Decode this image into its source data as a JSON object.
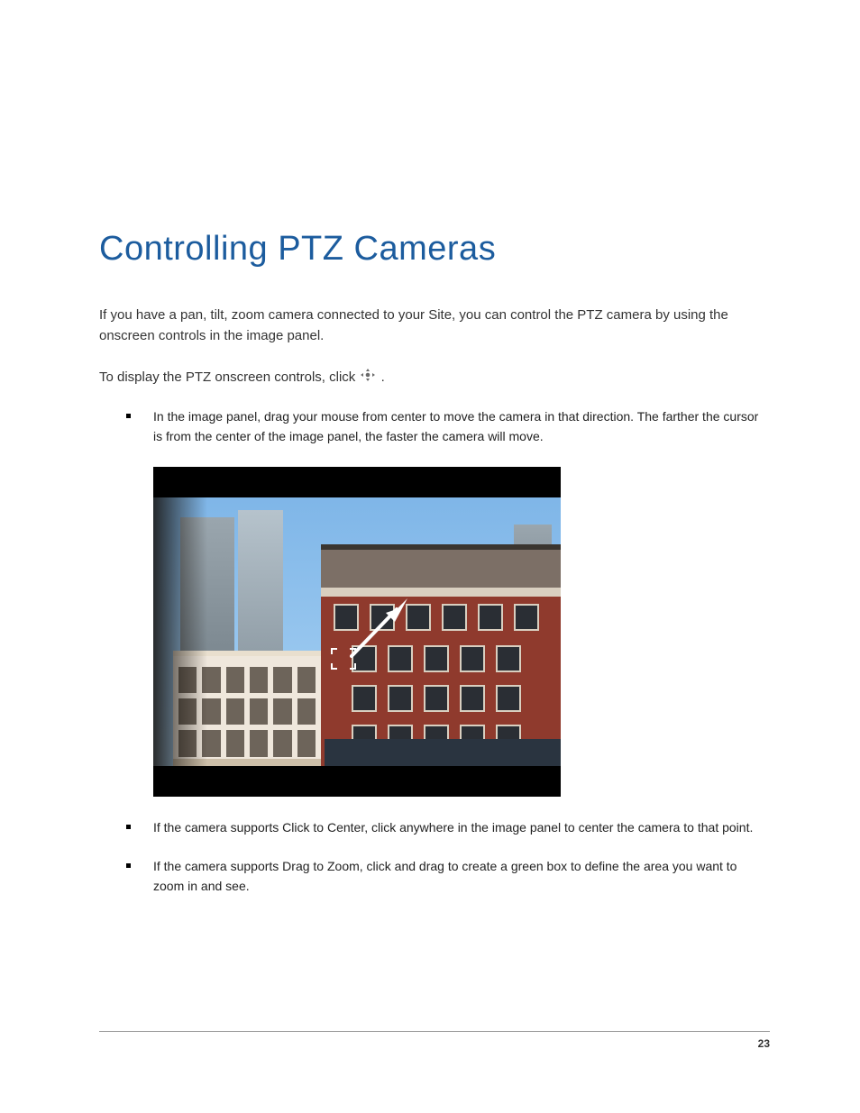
{
  "heading": "Controlling PTZ Cameras",
  "intro": "If you have a pan, tilt, zoom camera connected to your Site, you can control the PTZ camera by using the onscreen controls in the image panel.",
  "display_controls_prefix": "To display the PTZ onscreen controls, click ",
  "display_controls_suffix": ".",
  "ptz_icon_name": "ptz-controls-icon",
  "bullets": [
    "In the image panel, drag your mouse from center to move the camera in that direction. The farther the cursor is from the center of the image panel, the faster the camera will move.",
    "If the camera supports Click to Center, click anywhere in the image panel to center the camera to that point.",
    "If the camera supports Drag to Zoom, click and drag to create a green box to define the area you want to zoom in and see."
  ],
  "page_number": "23"
}
